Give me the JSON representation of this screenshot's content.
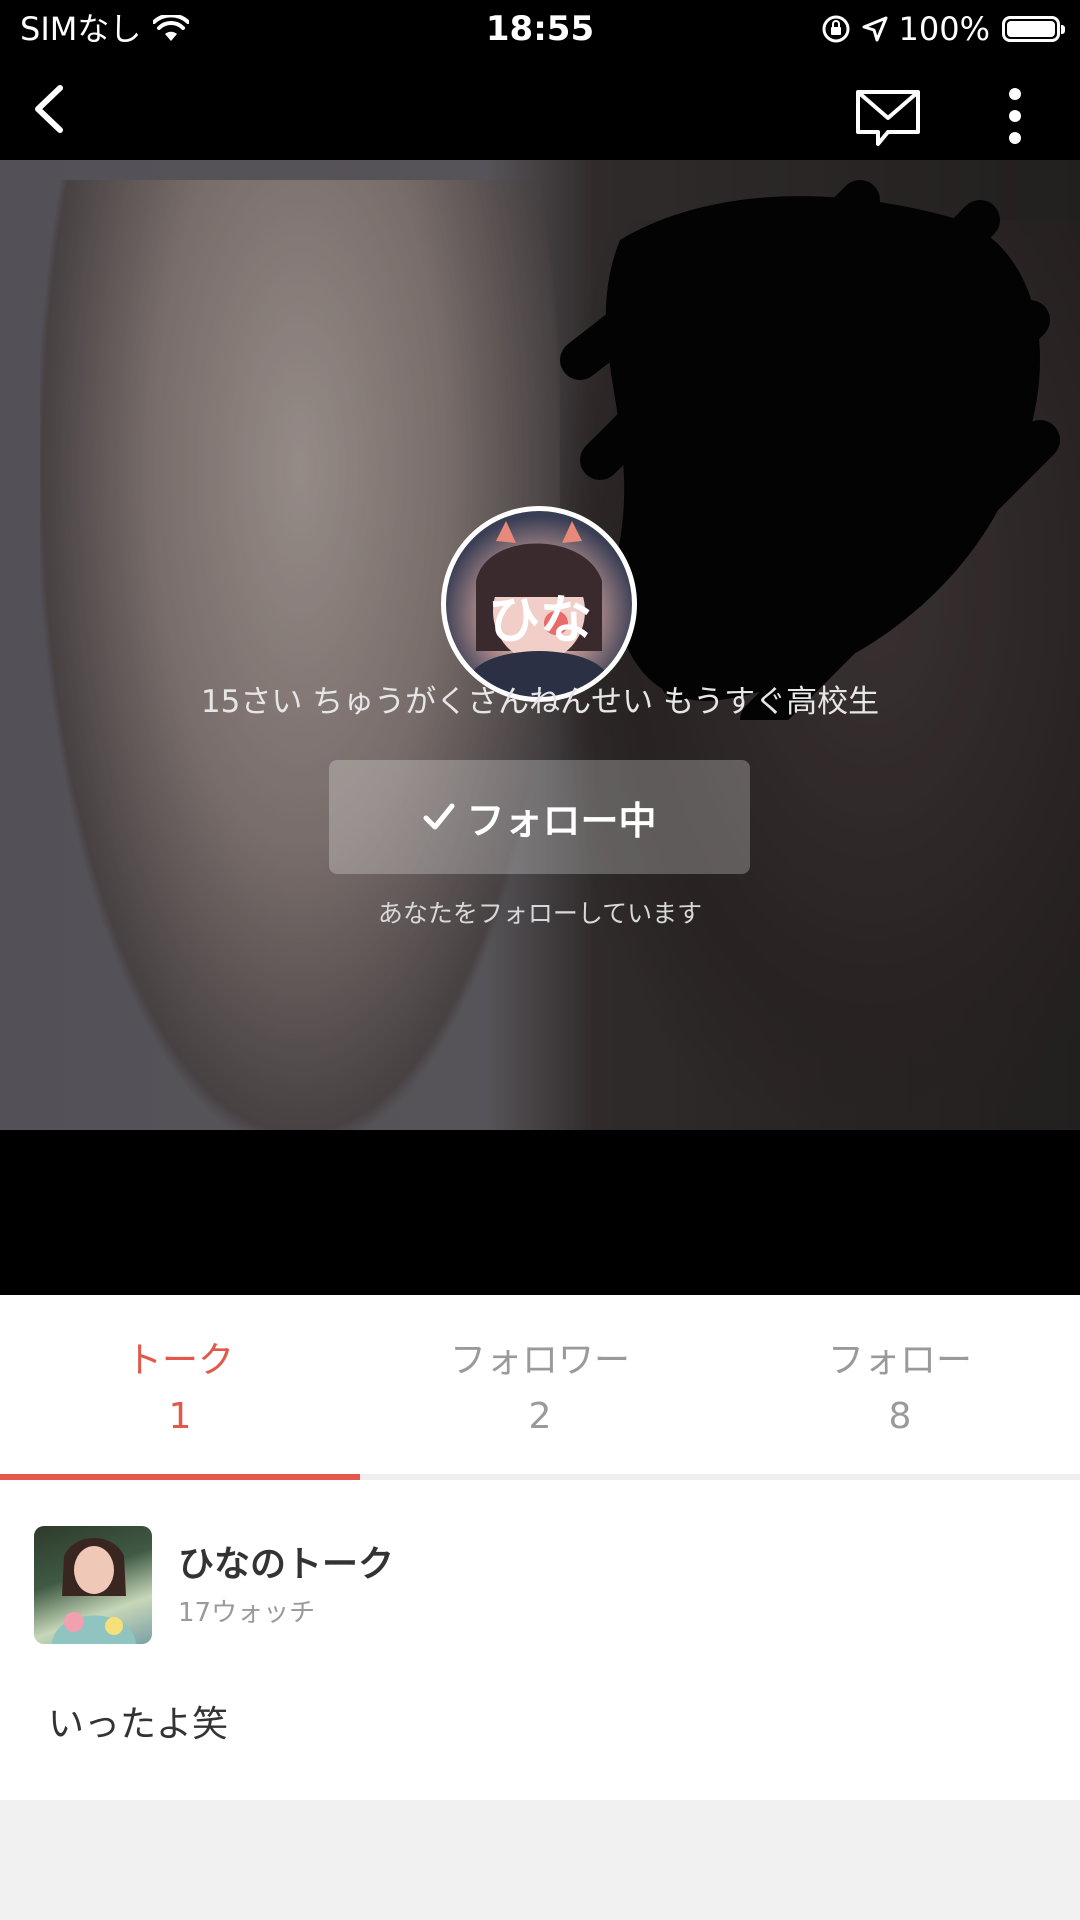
{
  "status_bar": {
    "carrier": "SIMなし",
    "time": "18:55",
    "battery": "100%",
    "battery_level": 1.0
  },
  "nav": {
    "back_icon": "chevron-left-icon",
    "message_icon": "envelope-icon",
    "more_icon": "more-vertical-icon"
  },
  "profile": {
    "name": "ひな",
    "bio": "15さい ちゅうがくさんねんせい もうすぐ高校生",
    "follow_button_label": "フォロー中",
    "follow_note": "あなたをフォローしています"
  },
  "tabs": [
    {
      "label": "トーク",
      "count": "1",
      "active": true
    },
    {
      "label": "フォロワー",
      "count": "2",
      "active": false
    },
    {
      "label": "フォロー",
      "count": "8",
      "active": false
    }
  ],
  "talk": {
    "title": "ひなのトーク",
    "watch": "17ウォッチ",
    "message": "いったよ笑"
  },
  "colors": {
    "accent": "#e4584b",
    "bar_background": "#000000"
  }
}
